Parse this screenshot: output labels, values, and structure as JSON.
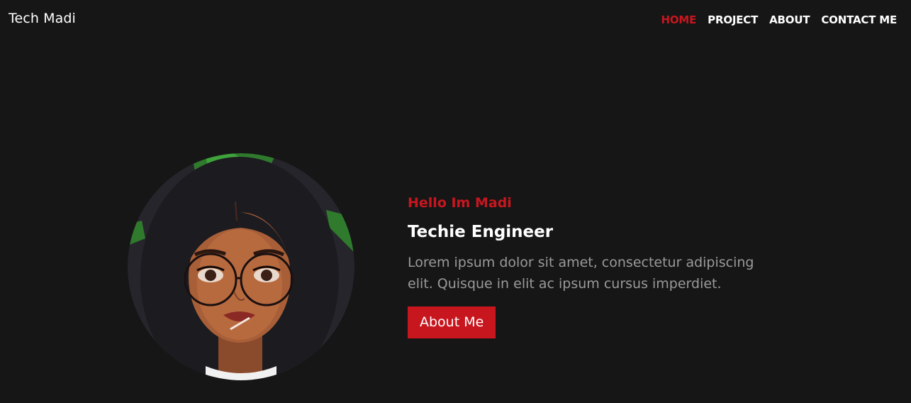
{
  "nav": {
    "brand": "Tech Madi",
    "links": [
      {
        "label": "HOME",
        "active": true
      },
      {
        "label": "PROJECT",
        "active": false
      },
      {
        "label": "ABOUT",
        "active": false
      },
      {
        "label": "CONTACT ME",
        "active": false
      }
    ]
  },
  "hero": {
    "greeting": "Hello Im Madi",
    "title": "Techie Engineer",
    "description": "Lorem ipsum dolor sit amet, consectetur adipiscing elit. Quisque in elit ac ipsum cursus imperdiet.",
    "button_label": "About Me",
    "avatar_icon": "cartoon-girl-with-glasses-avatar"
  },
  "colors": {
    "background": "#161616",
    "accent": "#c8161f",
    "text": "#ffffff",
    "muted": "#9a9a9a"
  }
}
